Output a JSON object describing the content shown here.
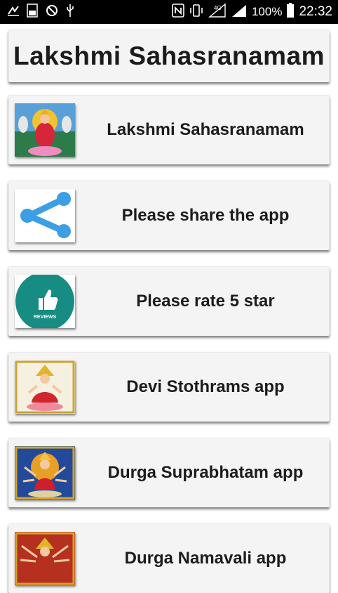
{
  "status_bar": {
    "battery_percent": "100%",
    "time": "22:32",
    "network": "4G",
    "icons": [
      "notification-arrow-icon",
      "storage-100-icon",
      "no-sim-icon",
      "usb-icon",
      "nfc-icon",
      "vibrate-icon",
      "signal-4g-icon",
      "signal-bars-icon",
      "battery-icon"
    ]
  },
  "header": {
    "title": "Lakshmi Sahasranamam"
  },
  "menu": {
    "items": [
      {
        "label": "Lakshmi Sahasranamam",
        "icon": "lakshmi-image-icon"
      },
      {
        "label": "Please share the app",
        "icon": "share-icon"
      },
      {
        "label": "Please rate 5 star",
        "icon": "thumbs-up-reviews-icon",
        "badge": "REVIEWS"
      },
      {
        "label": "Devi Stothrams app",
        "icon": "devi-image-icon"
      },
      {
        "label": "Durga Suprabhatam app",
        "icon": "durga-image-icon"
      },
      {
        "label": "Durga Namavali app",
        "icon": "durga-namavali-image-icon"
      }
    ]
  },
  "colors": {
    "status_bar": "#000000",
    "card": "#f4f4f4",
    "text": "#1c1c1c",
    "share_blue": "#3d9ee3",
    "reviews_teal": "#168c82"
  }
}
